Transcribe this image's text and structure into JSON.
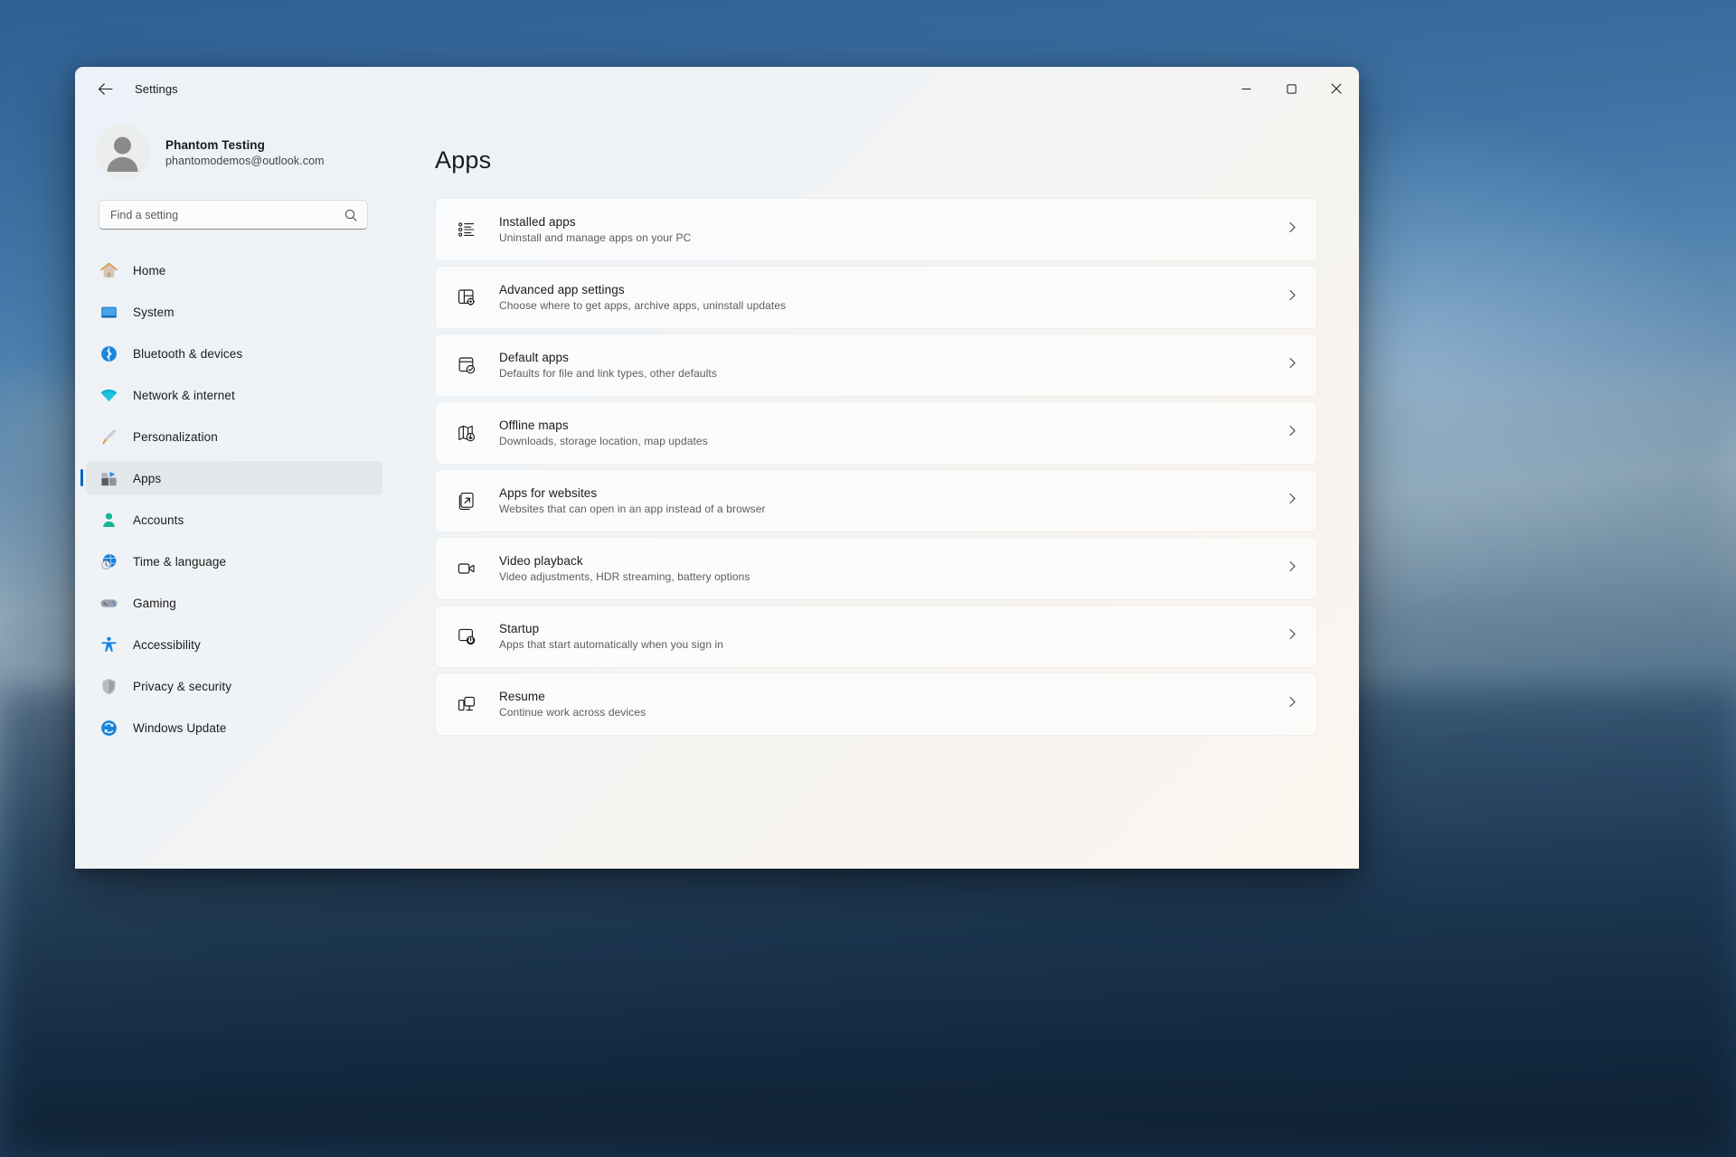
{
  "window": {
    "title": "Settings",
    "back_icon": "back-arrow-icon",
    "controls": {
      "minimize": "minimize-icon",
      "maximize": "maximize-icon",
      "close": "close-icon"
    }
  },
  "account": {
    "name": "Phantom Testing",
    "email": "phantomodemos@outlook.com",
    "avatar_icon": "person-avatar-icon"
  },
  "search": {
    "placeholder": "Find a setting",
    "value": "",
    "icon": "search-icon"
  },
  "sidebar": {
    "items": [
      {
        "label": "Home",
        "icon": "home-icon",
        "selected": false
      },
      {
        "label": "System",
        "icon": "system-monitor-icon",
        "selected": false
      },
      {
        "label": "Bluetooth & devices",
        "icon": "bluetooth-icon",
        "selected": false
      },
      {
        "label": "Network & internet",
        "icon": "wifi-icon",
        "selected": false
      },
      {
        "label": "Personalization",
        "icon": "paintbrush-icon",
        "selected": false
      },
      {
        "label": "Apps",
        "icon": "apps-icon",
        "selected": true
      },
      {
        "label": "Accounts",
        "icon": "account-person-icon",
        "selected": false
      },
      {
        "label": "Time & language",
        "icon": "clock-globe-icon",
        "selected": false
      },
      {
        "label": "Gaming",
        "icon": "gamepad-icon",
        "selected": false
      },
      {
        "label": "Accessibility",
        "icon": "accessibility-icon",
        "selected": false
      },
      {
        "label": "Privacy & security",
        "icon": "shield-icon",
        "selected": false
      },
      {
        "label": "Windows Update",
        "icon": "update-refresh-icon",
        "selected": false
      }
    ]
  },
  "main": {
    "title": "Apps",
    "cards": [
      {
        "title": "Installed apps",
        "subtitle": "Uninstall and manage apps on your PC",
        "icon": "bulleted-list-icon",
        "chevron": "chevron-right-icon"
      },
      {
        "title": "Advanced app settings",
        "subtitle": "Choose where to get apps, archive apps, uninstall updates",
        "icon": "app-settings-gear-icon",
        "chevron": "chevron-right-icon"
      },
      {
        "title": "Default apps",
        "subtitle": "Defaults for file and link types, other defaults",
        "icon": "default-app-check-icon",
        "chevron": "chevron-right-icon"
      },
      {
        "title": "Offline maps",
        "subtitle": "Downloads, storage location, map updates",
        "icon": "map-download-icon",
        "chevron": "chevron-right-icon"
      },
      {
        "title": "Apps for websites",
        "subtitle": "Websites that can open in an app instead of a browser",
        "icon": "open-external-icon",
        "chevron": "chevron-right-icon"
      },
      {
        "title": "Video playback",
        "subtitle": "Video adjustments, HDR streaming, battery options",
        "icon": "video-camera-icon",
        "chevron": "chevron-right-icon"
      },
      {
        "title": "Startup",
        "subtitle": "Apps that start automatically when you sign in",
        "icon": "startup-power-icon",
        "chevron": "chevron-right-icon"
      },
      {
        "title": "Resume",
        "subtitle": "Continue work across devices",
        "icon": "resume-devices-icon",
        "chevron": "chevron-right-icon"
      }
    ]
  },
  "colors": {
    "accent": "#0067c0",
    "window_bg": "#f3f3f3",
    "text_primary": "#1b1b1b",
    "text_secondary": "#5d5d5d",
    "close_hover": "#c42b1c"
  }
}
